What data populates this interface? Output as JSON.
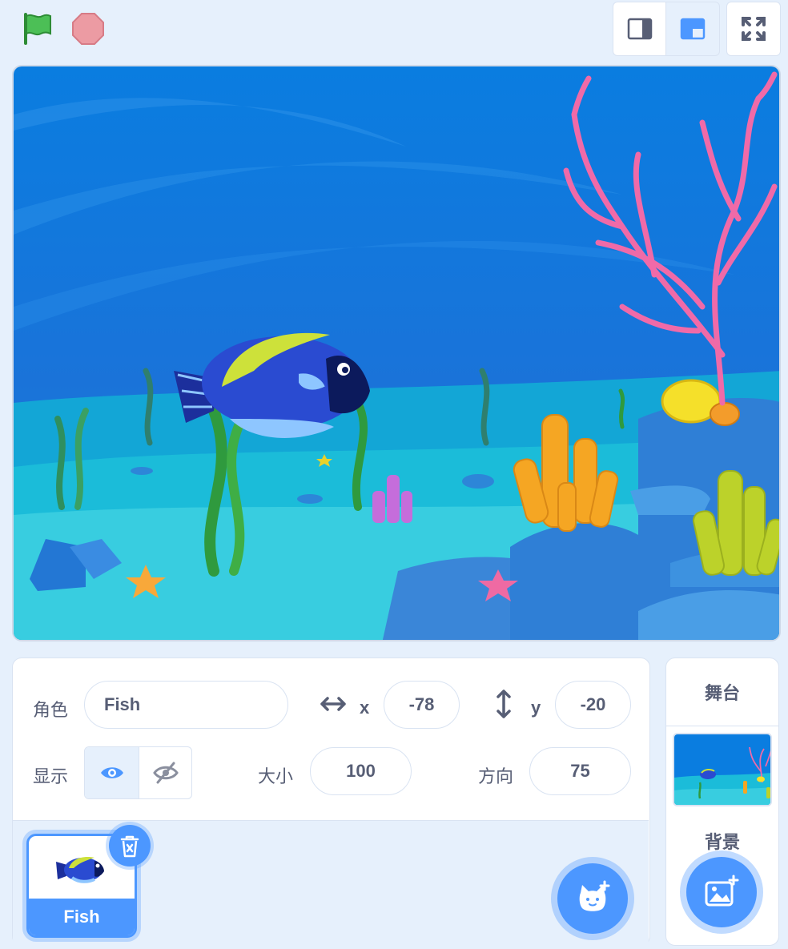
{
  "colors": {
    "accent": "#4c97ff",
    "text": "#575e75",
    "panel_bg": "#e6f0fc",
    "green_flag": "#4cbf56",
    "stop": "#ec9ba3"
  },
  "controls": {
    "green_flag_icon": "green-flag-icon",
    "stop_icon": "stop-icon",
    "small_stage_icon": "small-stage-icon",
    "normal_stage_icon": "normal-stage-icon",
    "fullscreen_icon": "fullscreen-icon"
  },
  "sprite_info": {
    "sprite_label": "角色",
    "sprite_name": "Fish",
    "x_label": "x",
    "x_value": "-78",
    "y_label": "y",
    "y_value": "-20",
    "show_label": "显示",
    "size_label": "大小",
    "size_value": "100",
    "direction_label": "方向",
    "direction_value": "75"
  },
  "sprites": [
    {
      "name": "Fish",
      "selected": true
    }
  ],
  "stage_panel": {
    "title": "舞台",
    "backdrops_label": "背景"
  }
}
